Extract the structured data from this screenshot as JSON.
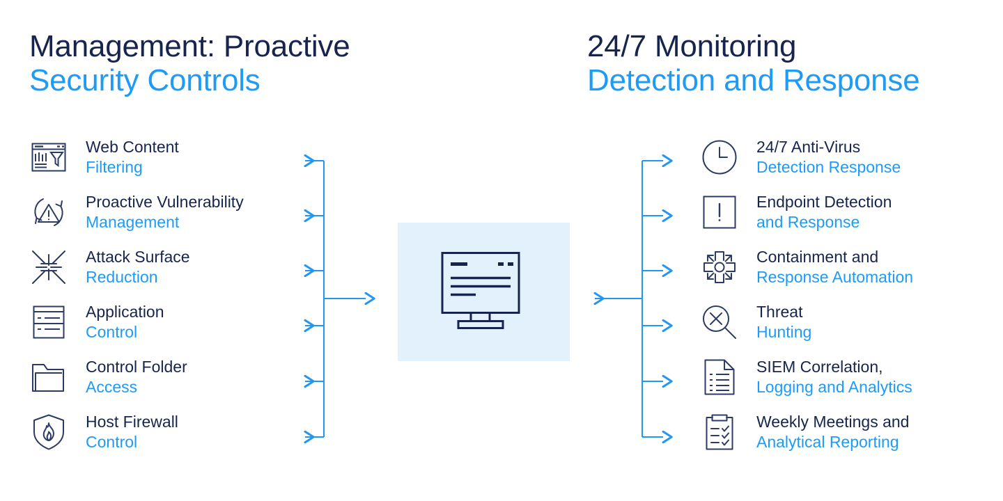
{
  "headings": {
    "left": {
      "line1": "Management: Proactive",
      "line2": "Security Controls"
    },
    "right": {
      "line1": "24/7 Monitoring",
      "line2": "Detection and Response"
    }
  },
  "colors": {
    "accent_blue": "#1e9bf4",
    "dark_navy": "#17254e",
    "panel_bg": "#e3f1fd",
    "page_bg": "#ffffff"
  },
  "left_column": {
    "items": [
      {
        "icon": "web-content-filtering-icon",
        "line1": "Web Content",
        "line2": "Filtering"
      },
      {
        "icon": "vulnerability-warning-icon",
        "line1": "Proactive Vulnerability",
        "line2": "Management"
      },
      {
        "icon": "attack-surface-arrows-icon",
        "line1": "Attack Surface",
        "line2": "Reduction"
      },
      {
        "icon": "application-list-icon",
        "line1": "Application",
        "line2": "Control"
      },
      {
        "icon": "folder-icon",
        "line1": "Control Folder",
        "line2": "Access"
      },
      {
        "icon": "shield-flame-icon",
        "line1": "Host Firewall",
        "line2": "Control"
      }
    ]
  },
  "right_column": {
    "items": [
      {
        "icon": "clock-icon",
        "line1": "24/7 Anti-Virus",
        "line2": "Detection Response"
      },
      {
        "icon": "alert-square-icon",
        "line1": "Endpoint Detection",
        "line2": "and Response"
      },
      {
        "icon": "containment-burst-icon",
        "line1": "Containment and",
        "line2": "Response Automation"
      },
      {
        "icon": "threat-magnifier-icon",
        "line1": "Threat",
        "line2": "Hunting"
      },
      {
        "icon": "document-list-icon",
        "line1": "SIEM Correlation,",
        "line2": "Logging and Analytics"
      },
      {
        "icon": "clipboard-check-icon",
        "line1": "Weekly Meetings and",
        "line2": "Analytical Reporting"
      }
    ]
  },
  "center": {
    "graphic": "monitor-icon"
  }
}
